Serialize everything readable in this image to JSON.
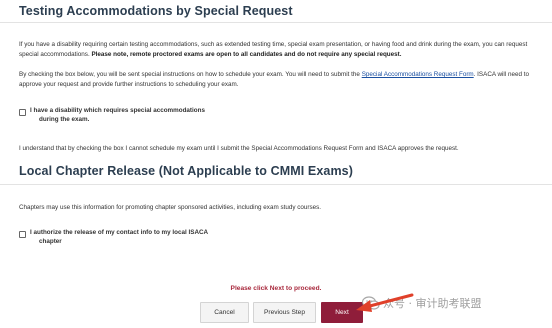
{
  "accommodations": {
    "title": "Testing Accommodations by Special Request",
    "para1_text": "If you have a disability requiring certain testing accommodations, such as extended testing time, special exam presentation, or having food and drink during the exam, you can request special accommodations. ",
    "para1_bold": "Please note, remote proctored exams are open to all candidates and do not require any special request.",
    "para2_before": "By checking the box below, you will be sent special instructions on how to schedule your exam. You will need to submit the ",
    "para2_link": "Special Accommodations Request Form",
    "para2_after": ". ISACA will need to approve your request and provide further instructions to scheduling your exam.",
    "checkbox_label_line1": "I have a disability which requires special accommodations",
    "checkbox_label_line2": "during the exam.",
    "understand_text": "I understand that by checking the box I cannot schedule my exam until I submit the Special Accommodations Request Form and ISACA approves the request."
  },
  "chapter_release": {
    "title": "Local Chapter Release (Not Applicable to CMMI Exams)",
    "para": "Chapters may use this information for promoting chapter sponsored activities, including exam study courses.",
    "checkbox_label_line1": "I authorize the release of my contact info to my local ISACA",
    "checkbox_label_line2": "chapter"
  },
  "footer": {
    "proceed_msg": "Please click Next to proceed.",
    "cancel_label": "Cancel",
    "previous_label": "Previous Step",
    "next_label": "Next"
  },
  "watermark": {
    "text": "众号 · 审计助考联盟",
    "icon": "wechat-icon"
  },
  "colors": {
    "title": "#2c3e50",
    "link": "#1a4fa0",
    "alert": "#a8283c",
    "primary_button": "#8f1d3a",
    "arrow": "#e0402a"
  }
}
